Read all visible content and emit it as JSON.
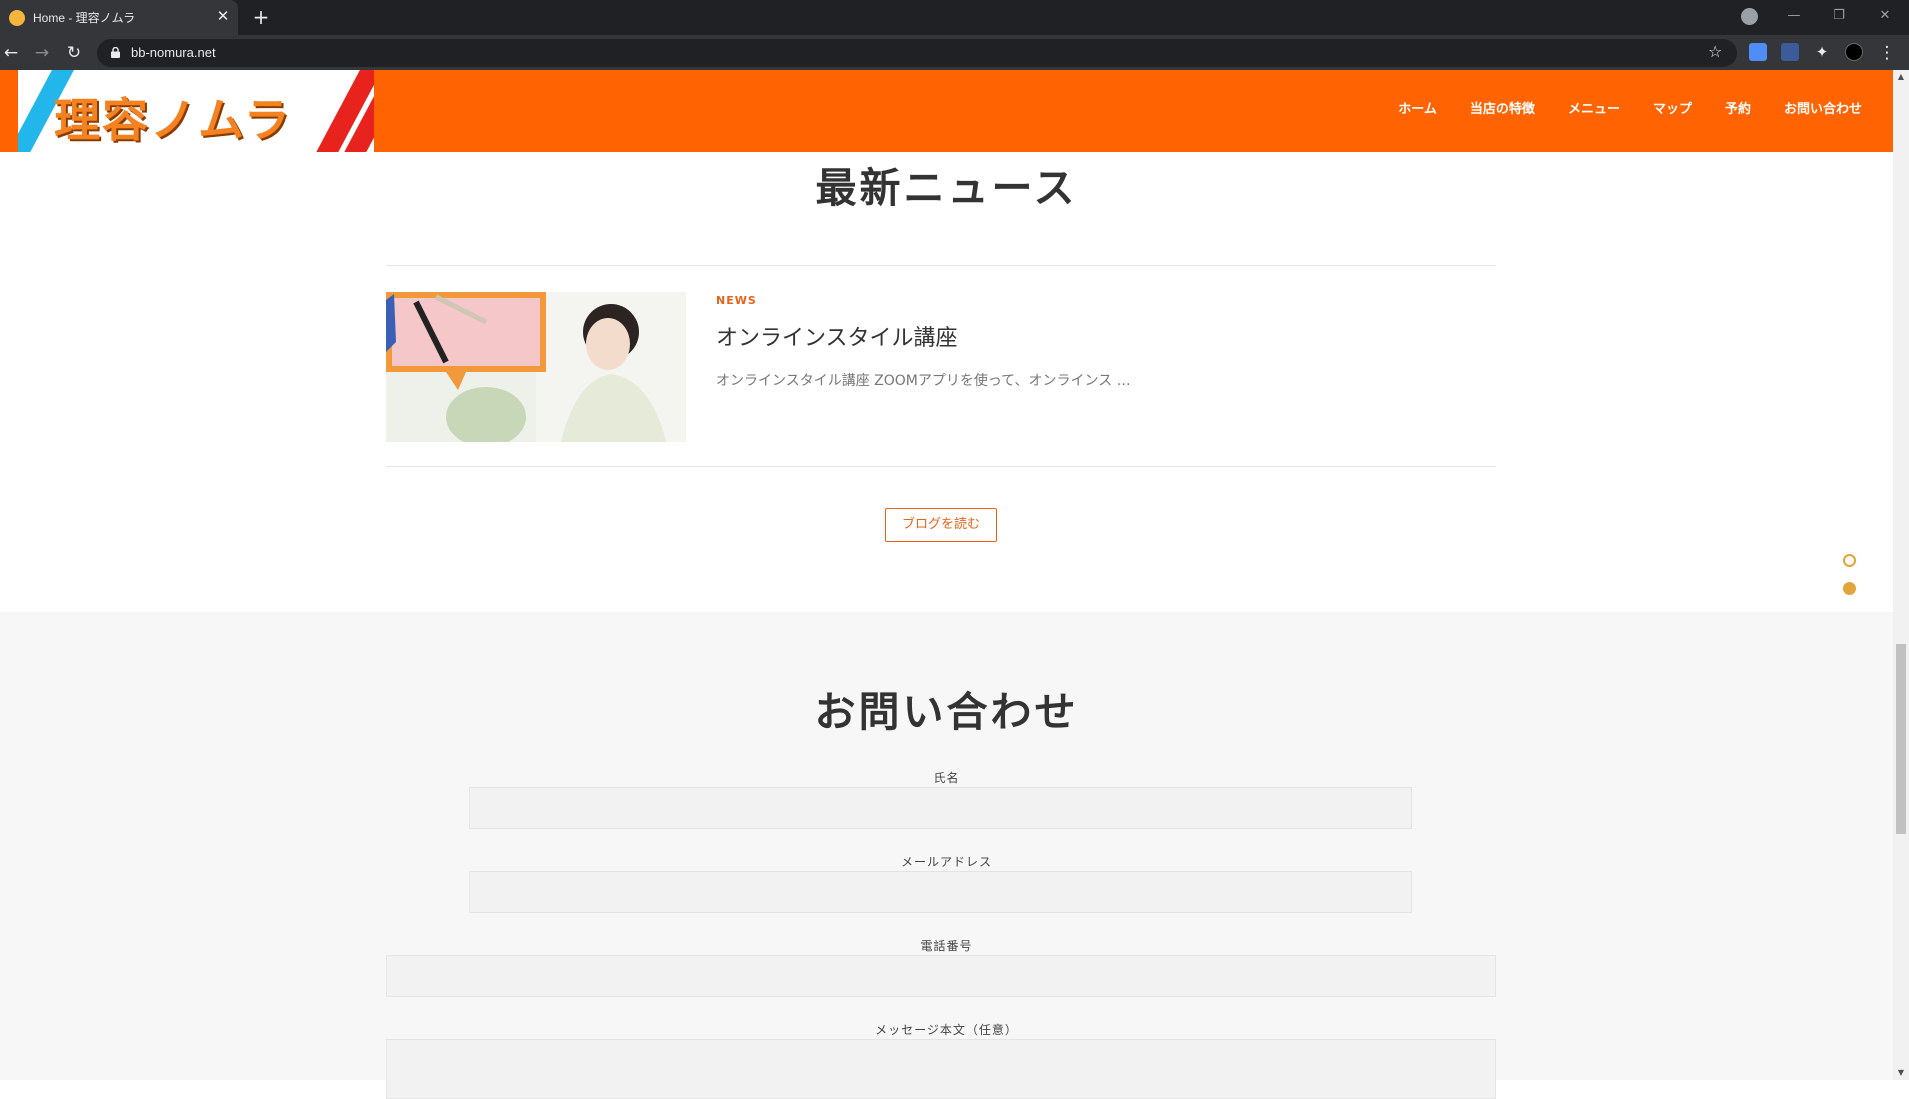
{
  "browser": {
    "tab_title": "Home - 理容ノムラ",
    "tab_close": "✕",
    "new_tab": "+",
    "url": "bb-nomura.net",
    "back": "←",
    "forward": "→",
    "reload": "↻",
    "bookmark": "☆",
    "minimize": "—",
    "restore": "❐",
    "close": "✕",
    "menu": "⋮"
  },
  "header": {
    "logo_text": "理容ノムラ",
    "nav": [
      "ホーム",
      "当店の特徴",
      "メニュー",
      "マップ",
      "予約",
      "お問い合わせ"
    ]
  },
  "news": {
    "title": "最新ニュース",
    "item": {
      "category": "NEWS",
      "title": "オンラインスタイル講座",
      "excerpt": "オンラインスタイル講座 ZOOMアプリを使って、オンラインス …"
    },
    "button": "ブログを読む"
  },
  "contact": {
    "title": "お問い合わせ",
    "fields": [
      "氏名",
      "メールアドレス",
      "電話番号",
      "メッセージ本文（任意）"
    ]
  },
  "colors": {
    "brand_orange": "#ff6302",
    "accent": "#e8631a",
    "dot": "#e1a53b"
  }
}
